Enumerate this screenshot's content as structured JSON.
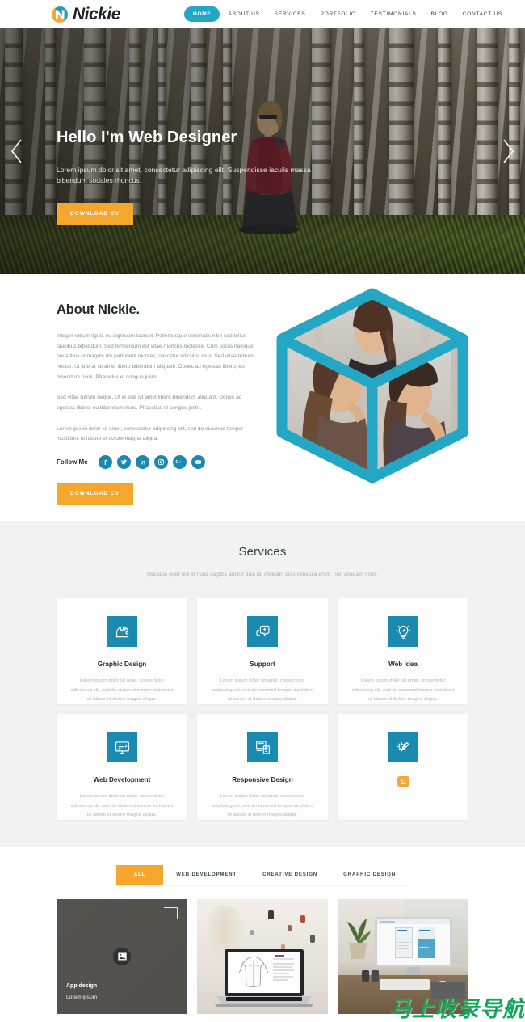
{
  "header": {
    "logo_text": "Nickie",
    "logo_icon": "nickie-n-logo",
    "nav": [
      {
        "label": "HOME",
        "active": true
      },
      {
        "label": "ABOUT US",
        "active": false
      },
      {
        "label": "SERVICES",
        "active": false
      },
      {
        "label": "PORTFOLIO",
        "active": false
      },
      {
        "label": "TESTIMONIALS",
        "active": false
      },
      {
        "label": "BLOG",
        "active": false
      },
      {
        "label": "CONTACT US",
        "active": false
      }
    ]
  },
  "hero": {
    "title": "Hello I'm Web Designer",
    "subtitle": "Lorem ipsum dolor sit amet, consectetur adipiscing elit. Suspendisse iaculis massa bibendum sodales rhoncus.",
    "cta_label": "DOWNLOAD CV",
    "prev_icon": "chevron-left-icon",
    "next_icon": "chevron-right-icon"
  },
  "about": {
    "title": "About Nickie.",
    "paragraphs": [
      "Integer rutrum ligula eu dignissim laoreet. Pellentesque venenatis nibh sed tellus faucibus bibendum. Sed fermentum est vitae rhoncus molestie. Cum sociis natoque penatibus et magnis dis parturient montes, nascetur ridiculus mus. Sed vitae rutrum neque. Ut id erat sit amet libero bibendum aliquam. Donec ac egestas libero, eu bibendum risus. Phasellus et congue justo.",
      "Sed vitae rutrum neque. Ut id erat sit amet libero bibendum aliquam. Donec ac egestas libero, eu bibendum risus. Phasellus et congue justo.",
      "Lorem ipsum dolor sit amet, consectetur adipiscing elit, sed do eiusmod tempor incididunt ut labore et dolore magna aliqua."
    ],
    "follow_label": "Follow Me",
    "social": [
      {
        "name": "facebook-icon",
        "glyph": "f"
      },
      {
        "name": "twitter-icon",
        "glyph": "t"
      },
      {
        "name": "linkedin-icon",
        "glyph": "in"
      },
      {
        "name": "instagram-icon",
        "glyph": "ig"
      },
      {
        "name": "google-plus-icon",
        "glyph": "G+"
      },
      {
        "name": "youtube-icon",
        "glyph": "yt"
      }
    ],
    "cta_label": "DOWNLOAD CV",
    "cube_image_alt": "photo-cube-three-faces"
  },
  "services": {
    "title": "Services",
    "subtitle": "Quisque eget nisl id nulla sagittis auctor quis id. Aliquam quis vehicula enim, non aliquam risus.",
    "body_text": "Lorem ipsum dolor sit amet, consectetur adipiscing elit, sed do eiusmod tempor incididunt ut labore et dolore magna aliqua.",
    "cards": [
      {
        "title": "Graphic Design",
        "icon": "head-gears-icon",
        "broken_image": false
      },
      {
        "title": "Support",
        "icon": "chat-support-icon",
        "broken_image": false
      },
      {
        "title": "Web Idea",
        "icon": "lightbulb-idea-icon",
        "broken_image": false
      },
      {
        "title": "Web Development",
        "icon": "monitor-code-icon",
        "broken_image": false
      },
      {
        "title": "Responsive Design",
        "icon": "responsive-devices-icon",
        "broken_image": false
      },
      {
        "title": "",
        "icon": "gear-screwdriver-icon",
        "broken_image": true
      }
    ]
  },
  "portfolio": {
    "filters": [
      {
        "label": "ALL",
        "active": true
      },
      {
        "label": "WEB DEVELOPMENT",
        "active": false
      },
      {
        "label": "CREATIVE DESIGN",
        "active": false
      },
      {
        "label": "GRAPHIC DESIGN",
        "active": false
      }
    ],
    "items": [
      {
        "title": "App design",
        "subtitle": "Lorem ipsum",
        "overlay": true,
        "icon": "image-placeholder-icon"
      },
      {
        "title": "",
        "subtitle": "",
        "overlay": false,
        "icon": "laptop-sketch-photo"
      },
      {
        "title": "",
        "subtitle": "",
        "overlay": false,
        "icon": "imac-desk-photo"
      }
    ]
  },
  "watermark": {
    "text": "马上收录导航"
  },
  "colors": {
    "teal": "#23a7c4",
    "icon_teal": "#1b8ab0",
    "orange": "#f5a62c",
    "dark_text": "#23282d",
    "muted_text": "#8b9096",
    "section_bg": "#f2f2f2",
    "watermark_green": "#11a65a"
  }
}
